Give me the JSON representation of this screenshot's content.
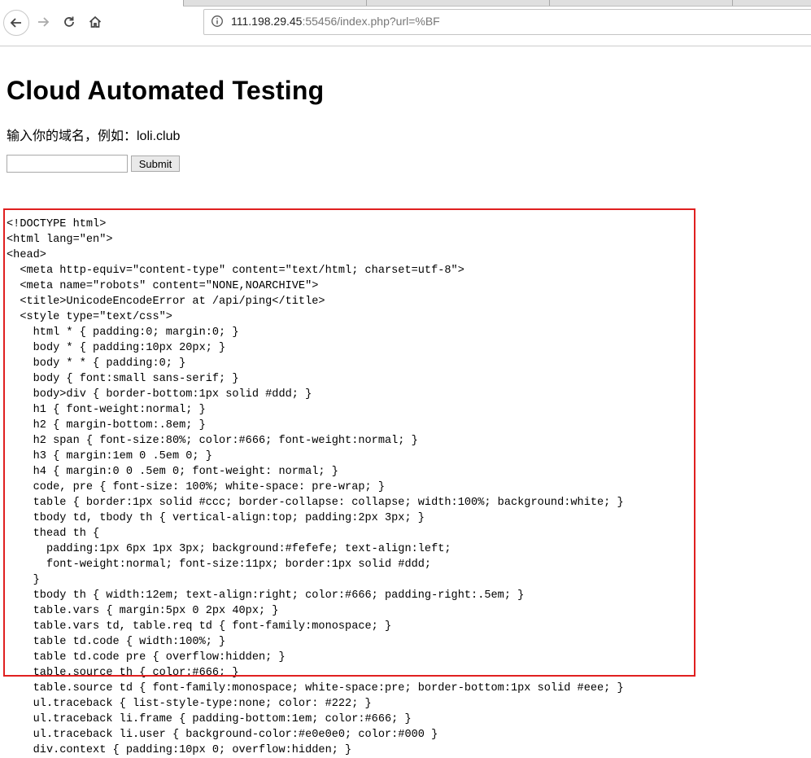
{
  "browser": {
    "url_host": "111.198.29.45",
    "url_rest": ":55456/index.php?url=%BF",
    "back_icon": "arrow-left-icon",
    "forward_icon": "arrow-right-icon",
    "reload_icon": "reload-icon",
    "home_icon": "home-icon",
    "info_icon": "info-icon"
  },
  "page": {
    "title": "Cloud Automated Testing",
    "prompt": "输入你的域名，例如：loli.club",
    "input_value": "",
    "submit_label": "Submit"
  },
  "code_lines": [
    "<!DOCTYPE html>",
    "<html lang=\"en\">",
    "<head>",
    "  <meta http-equiv=\"content-type\" content=\"text/html; charset=utf-8\">",
    "  <meta name=\"robots\" content=\"NONE,NOARCHIVE\">",
    "  <title>UnicodeEncodeError at /api/ping</title>",
    "  <style type=\"text/css\">",
    "    html * { padding:0; margin:0; }",
    "    body * { padding:10px 20px; }",
    "    body * * { padding:0; }",
    "    body { font:small sans-serif; }",
    "    body>div { border-bottom:1px solid #ddd; }",
    "    h1 { font-weight:normal; }",
    "    h2 { margin-bottom:.8em; }",
    "    h2 span { font-size:80%; color:#666; font-weight:normal; }",
    "    h3 { margin:1em 0 .5em 0; }",
    "    h4 { margin:0 0 .5em 0; font-weight: normal; }",
    "    code, pre { font-size: 100%; white-space: pre-wrap; }",
    "    table { border:1px solid #ccc; border-collapse: collapse; width:100%; background:white; }",
    "    tbody td, tbody th { vertical-align:top; padding:2px 3px; }",
    "    thead th {",
    "      padding:1px 6px 1px 3px; background:#fefefe; text-align:left;",
    "      font-weight:normal; font-size:11px; border:1px solid #ddd;",
    "    }",
    "    tbody th { width:12em; text-align:right; color:#666; padding-right:.5em; }",
    "    table.vars { margin:5px 0 2px 40px; }",
    "    table.vars td, table.req td { font-family:monospace; }",
    "    table td.code { width:100%; }",
    "    table td.code pre { overflow:hidden; }",
    "    table.source th { color:#666; }",
    "    table.source td { font-family:monospace; white-space:pre; border-bottom:1px solid #eee; }",
    "    ul.traceback { list-style-type:none; color: #222; }",
    "    ul.traceback li.frame { padding-bottom:1em; color:#666; }",
    "    ul.traceback li.user { background-color:#e0e0e0; color:#000 }",
    "    div.context { padding:10px 0; overflow:hidden; }"
  ]
}
